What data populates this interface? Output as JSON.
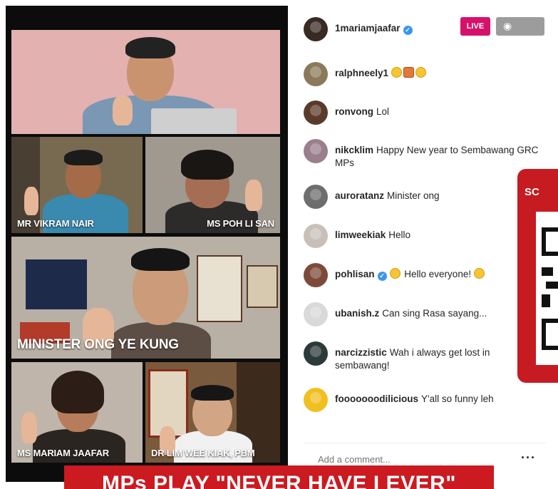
{
  "video": {
    "participants": [
      {
        "caption": ""
      },
      {
        "caption": "MR VIKRAM NAIR"
      },
      {
        "caption": "MS POH LI SAN"
      },
      {
        "caption": "MINISTER ONG YE KUNG"
      },
      {
        "caption": "MS MARIAM JAAFAR"
      },
      {
        "caption": "DR LIM WEE KIAK, PBM"
      }
    ]
  },
  "header": {
    "host": "1mariamjaafar",
    "live_label": "LIVE",
    "viewers_icon": "eye-icon"
  },
  "comments": [
    {
      "user": "ralphneely1",
      "text": "",
      "verified": false,
      "avatar_color": "#8a7a5a"
    },
    {
      "user": "ronvong",
      "text": "Lol",
      "verified": false,
      "avatar_color": "#5b3a2a"
    },
    {
      "user": "nikcklim",
      "text": "Happy New year to Sembawang GRC MPs",
      "verified": false,
      "avatar_color": "#9a7f8d"
    },
    {
      "user": "auroratanz",
      "text": "Minister ong",
      "verified": false,
      "avatar_color": "#6d6d6d"
    },
    {
      "user": "limweekiak",
      "text": "Hello",
      "verified": false,
      "avatar_color": "#c8c0b8"
    },
    {
      "user": "pohlisan",
      "text": "Hello everyone!",
      "verified": true,
      "avatar_color": "#7d4a3a"
    },
    {
      "user": "ubanish.z",
      "text": "Can sing Rasa sayang...",
      "verified": false,
      "avatar_color": "#d9d9d9"
    },
    {
      "user": "narcizzistic",
      "text": "Wah i always get lost in sembawang!",
      "verified": false,
      "avatar_color": "#2d3a3a"
    },
    {
      "user": "fooooooodilicious",
      "text": "Y'all so funny leh",
      "verified": false,
      "avatar_color": "#f0c020"
    }
  ],
  "comment_input": {
    "placeholder": "Add a comment...",
    "more_icon": "more-icon"
  },
  "overlay": {
    "qr_title": "SC",
    "headline": "MPs PLAY \"NEVER HAVE I EVER\"",
    "accent": "#c51b21"
  }
}
